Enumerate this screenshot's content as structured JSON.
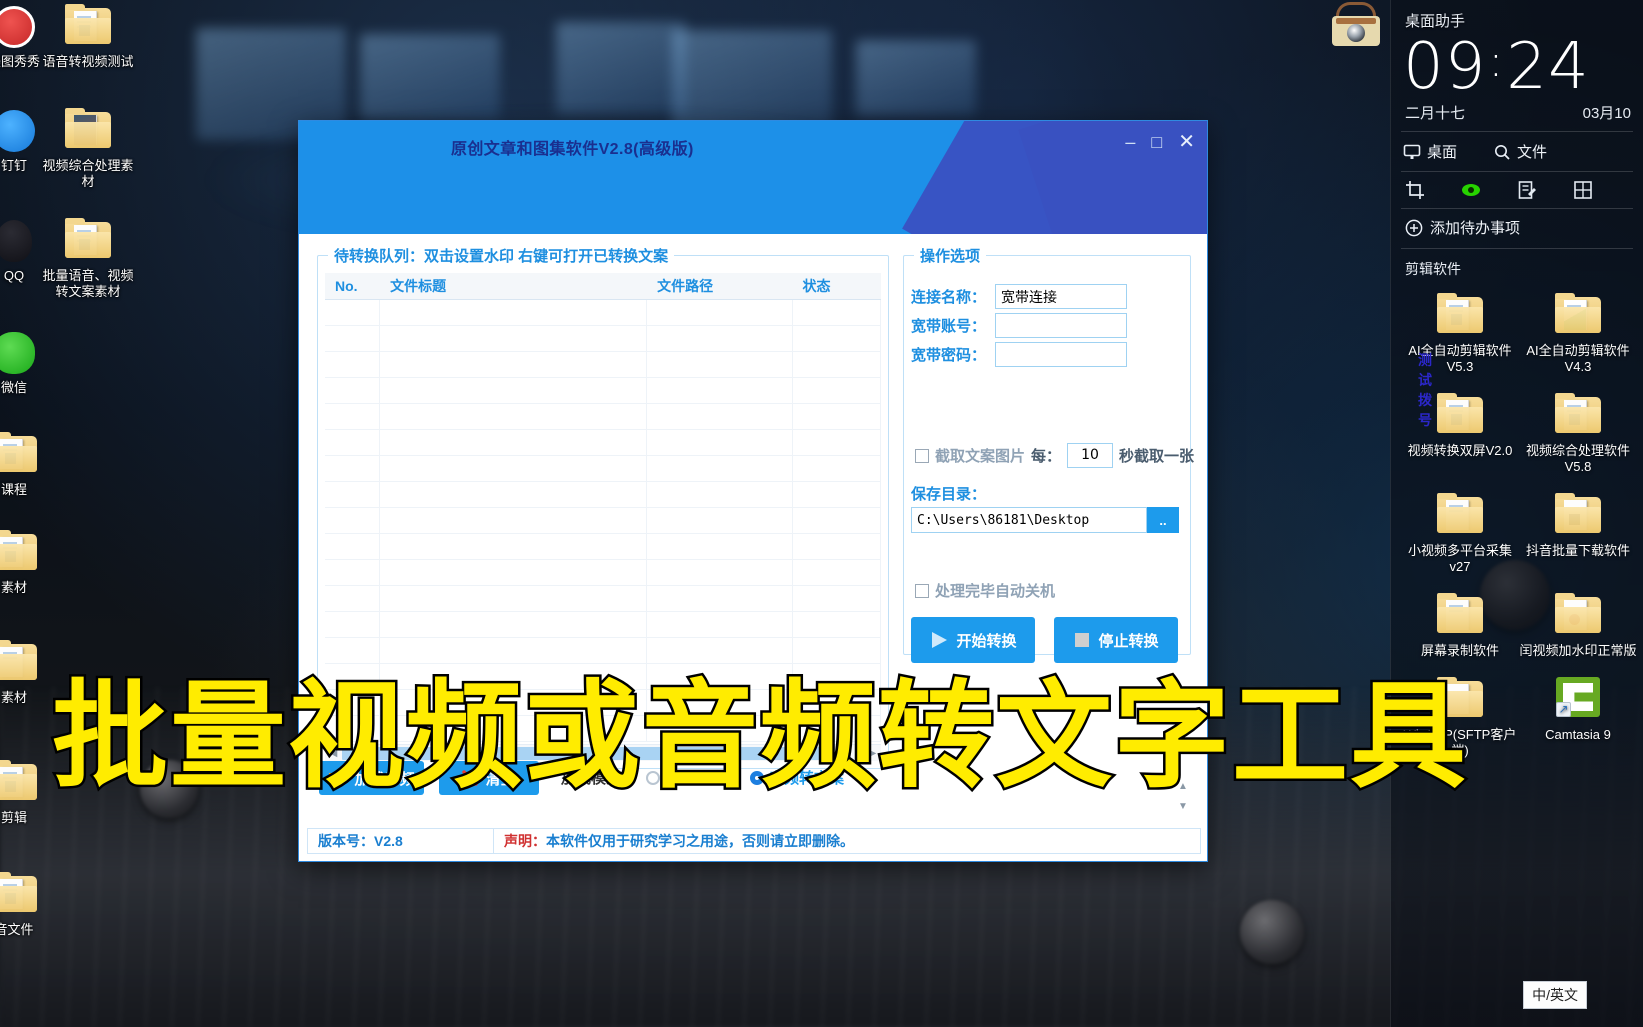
{
  "desktop": {
    "left_icons": [
      {
        "label": "美图秀秀",
        "type": "app-round",
        "color": "#c62828"
      },
      {
        "label": "语音转视频测试",
        "type": "folder"
      },
      {
        "label": "钉钉",
        "type": "app-round",
        "color": "#1a8cf0"
      },
      {
        "label": "视频综合处理素材",
        "type": "folder"
      },
      {
        "label": "QQ",
        "type": "app-round",
        "color": "#12121a"
      },
      {
        "label": "批量语音、视频转文案素材",
        "type": "folder"
      },
      {
        "label": "微信",
        "type": "app-round",
        "color": "#1aad19"
      },
      {
        "label": "课程",
        "type": "folder"
      },
      {
        "label": "素材",
        "type": "folder"
      },
      {
        "label": "素材",
        "type": "folder"
      },
      {
        "label": "剪辑",
        "type": "folder"
      },
      {
        "label": "音文件",
        "type": "folder"
      }
    ]
  },
  "assistant": {
    "title": "桌面助手",
    "clock": {
      "hours": "09",
      "separator": ":",
      "minutes": "24"
    },
    "lunar_date": "二月十七",
    "solar_date": "03月10",
    "quick_links": [
      {
        "label": "桌面",
        "icon": "monitor-icon"
      },
      {
        "label": "文件",
        "icon": "search-icon"
      }
    ],
    "tool_icons": [
      "crop-icon",
      "eye-icon",
      "note-icon",
      "grid-icon"
    ],
    "add_todo": "添加待办事项",
    "section_title": "剪辑软件",
    "folders": [
      {
        "label": "AI全自动剪辑软件V5.3"
      },
      {
        "label": "AI全自动剪辑软件V4.3"
      },
      {
        "label": "视频转换双屏V2.0"
      },
      {
        "label": "视频综合处理软件V5.8"
      },
      {
        "label": "小视频多平台采集v27"
      },
      {
        "label": "抖音批量下载软件"
      },
      {
        "label": "屏幕录制软件"
      },
      {
        "label": "闰视频加水印正常版"
      },
      {
        "label": "WinSCP(SFTP客户端)"
      },
      {
        "label": "Camtasia 9"
      }
    ]
  },
  "app": {
    "title": "原创文章和图集软件V2.8(高级版)",
    "window_controls": {
      "minimize": "–",
      "maximize": "□",
      "close": "✕"
    },
    "queue": {
      "legend": "待转换队列：双击设置水印 右键可打开已转换文案",
      "columns": [
        "No.",
        "文件标题",
        "文件路径",
        "状态"
      ],
      "rows": []
    },
    "toolbar": {
      "load_button": "加载音频",
      "load_icon": "folder-open-icon",
      "clear_button": "清空",
      "clear_icon": "x-mark-icon",
      "mode_label": "加载模式：",
      "modes": [
        {
          "label": "视频转文案",
          "selected": false
        },
        {
          "label": "音频转文案",
          "selected": true
        }
      ]
    },
    "options": {
      "legend": "操作选项",
      "connection_name_label": "连接名称：",
      "connection_name_value": "宽带连接",
      "account_label": "宽带账号：",
      "account_value": "",
      "password_label": "宽带密码：",
      "password_value": "",
      "test_dial_link": "测试拨号",
      "capture_checkbox_label": "截取文案图片",
      "capture_every_label": "每：",
      "capture_interval": "10",
      "capture_suffix": "秒截取一张",
      "save_dir_label": "保存目录：",
      "save_dir_value": "C:\\Users\\86181\\Desktop",
      "browse_button": "..",
      "shutdown_checkbox_label": "处理完毕自动关机",
      "start_button": "开始转换",
      "start_icon": "play-icon",
      "stop_button": "停止转换",
      "stop_icon": "stop-icon"
    },
    "statusbar": {
      "version_label": "版本号：V2.8",
      "disclaimer_label": "声明：",
      "disclaimer_text": "本软件仅用于研究学习之用途，否则请立即删除。"
    }
  },
  "caption": {
    "text": "批量视频或音频转文字工具",
    "color": "#ffec00"
  },
  "taskbar": {
    "ime_label": "中/英文"
  }
}
